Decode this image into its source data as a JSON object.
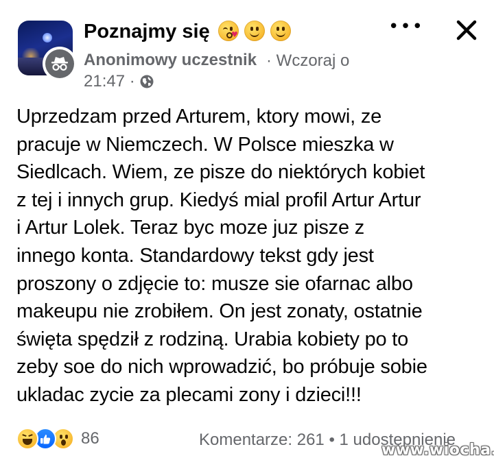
{
  "post": {
    "group_name": "Poznajmy się",
    "header_emojis": [
      "kissing-heart-emoji",
      "smiling-emoji",
      "smiling-emoji"
    ],
    "author": "Anonimowy uczestnik",
    "meta_line1": "· Wczoraj o",
    "meta_line2": "21:47 ·",
    "text_lines": [
      "Uprzedzam przed Arturem, ktory mowi, ze",
      "pracuje w Niemczech. W Polsce mieszka w",
      "Siedlcach. Wiem, ze pisze do niektórych kobiet",
      "z tej i innych grup. Kiedyś mial profil Artur Artur",
      "i Artur Lolek. Teraz byc moze juz pisze z",
      "innego konta. Standardowy tekst gdy jest",
      "proszony o zdjęcie to: musze sie ofarnac albo",
      "makeupu nie zrobiłem. On jest zonaty, ostatnie",
      "święta spędził z rodziną. Urabia kobiety po to",
      "zeby soe do nich wprowadzić, bo próbuje sobie",
      "ukladac zycie za plecami zony i dzieci!!!"
    ]
  },
  "footer": {
    "reactions": [
      "haha-reaction-icon",
      "like-reaction-icon",
      "wow-reaction-icon"
    ],
    "reaction_count": "86",
    "comments_shares": "Komentarze: 261 • 1 udostępnienie"
  },
  "watermark": "www.wiocha.pl",
  "colors": {
    "text": "#050505",
    "secondary": "#65676b",
    "like_blue": "#0866ff",
    "background": "#ffffff"
  }
}
